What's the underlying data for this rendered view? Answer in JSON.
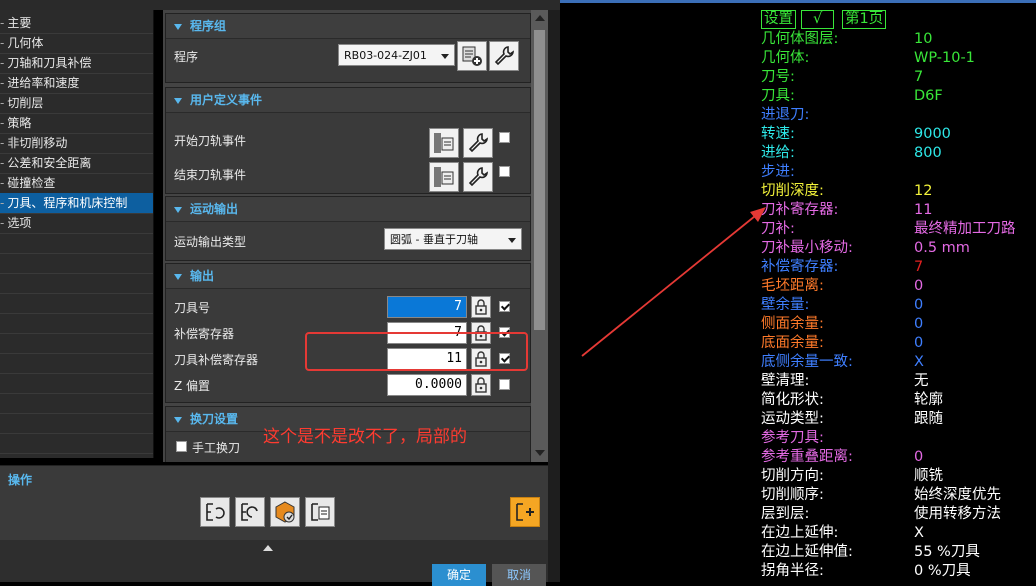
{
  "tree": {
    "items": [
      "主要",
      "几何体",
      "刀轴和刀具补偿",
      "进给率和速度",
      "切削层",
      "策略",
      "非切削移动",
      "公差和安全距离",
      "碰撞检查",
      "刀具、程序和机床控制",
      "选项"
    ],
    "prefix": "-",
    "selected_index": 9
  },
  "program_group": {
    "title": "程序组",
    "program_label": "程序",
    "program_value": "RB03-024-ZJ01"
  },
  "user_events": {
    "title": "用户定义事件",
    "start_label": "开始刀轨事件",
    "end_label": "结束刀轨事件"
  },
  "motion_output": {
    "title": "运动输出",
    "type_label": "运动输出类型",
    "type_value": "圆弧 - 垂直于刀轴"
  },
  "output": {
    "title": "输出",
    "rows": [
      {
        "label": "刀具号",
        "value": "7",
        "checked": true,
        "active": true
      },
      {
        "label": "补偿寄存器",
        "value": "7",
        "checked": true,
        "active": false
      },
      {
        "label": "刀具补偿寄存器",
        "value": "11",
        "checked": true,
        "active": false
      },
      {
        "label": "Z 偏置",
        "value": "0.0000",
        "checked": false,
        "active": false
      }
    ]
  },
  "tool_change": {
    "title": "换刀设置",
    "manual_label": "手工换刀"
  },
  "operations": {
    "title": "操作"
  },
  "buttons": {
    "ok": "确定",
    "cancel": "取消"
  },
  "annotation": {
    "text": "这个是不是改不了，局部的",
    "color": "#ff3b30"
  },
  "cam_header": {
    "settings": "设置",
    "check": "√",
    "page": "第1页"
  },
  "cam_rows": [
    {
      "label": "几何体图层:",
      "value": "10",
      "label_color": "#39e639",
      "value_color": "#39e639"
    },
    {
      "label": "几何体:",
      "value": "WP-10-1",
      "label_color": "#39e639",
      "value_color": "#39e639"
    },
    {
      "label": "刀号:",
      "value": "7",
      "label_color": "#39e639",
      "value_color": "#39e639"
    },
    {
      "label": "刀具:",
      "value": "D6F",
      "label_color": "#39e639",
      "value_color": "#39e639"
    },
    {
      "label": "进退刀:",
      "value": "",
      "label_color": "#3f7fff",
      "value_color": "#3f7fff"
    },
    {
      "label": "转速:",
      "value": "9000",
      "label_color": "#2ee8e8",
      "value_color": "#2ee8e8"
    },
    {
      "label": "进给:",
      "value": "800",
      "label_color": "#2ee8e8",
      "value_color": "#2ee8e8"
    },
    {
      "label": "步进:",
      "value": "",
      "label_color": "#3f7fff",
      "value_color": "#3f7fff"
    },
    {
      "label": "切削深度:",
      "value": "12",
      "label_color": "#f2f23a",
      "value_color": "#f2f23a"
    },
    {
      "label": "刀补寄存器:",
      "value": "11",
      "label_color": "#e46ae4",
      "value_color": "#e46ae4"
    },
    {
      "label": "刀补:",
      "value": "最终精加工刀路",
      "label_color": "#e46ae4",
      "value_color": "#e46ae4"
    },
    {
      "label": "刀补最小移动:",
      "value": "0.5  mm",
      "label_color": "#e46ae4",
      "value_color": "#e46ae4"
    },
    {
      "label": "补偿寄存器:",
      "value": "7",
      "label_color": "#3f7fff",
      "value_color": "#e02020"
    },
    {
      "label": "毛坯距离:",
      "value": "0",
      "label_color": "#ff7a2a",
      "value_color": "#e46ae4"
    },
    {
      "label": "壁余量:",
      "value": "0",
      "label_color": "#3f7fff",
      "value_color": "#3f7fff"
    },
    {
      "label": "侧面余量:",
      "value": "0",
      "label_color": "#ff7a2a",
      "value_color": "#3f7fff"
    },
    {
      "label": "底面余量:",
      "value": "0",
      "label_color": "#ff7a2a",
      "value_color": "#3f7fff"
    },
    {
      "label": "底侧余量一致:",
      "value": "X",
      "label_color": "#3f7fff",
      "value_color": "#3f7fff"
    },
    {
      "label": "壁清理:",
      "value": "无",
      "label_color": "#ffffff",
      "value_color": "#ffffff"
    },
    {
      "label": "简化形状:",
      "value": "轮廓",
      "label_color": "#ffffff",
      "value_color": "#ffffff"
    },
    {
      "label": "运动类型:",
      "value": "跟随",
      "label_color": "#ffffff",
      "value_color": "#ffffff"
    },
    {
      "label": "参考刀具:",
      "value": "",
      "label_color": "#e46ae4",
      "value_color": "#e46ae4"
    },
    {
      "label": "参考重叠距离:",
      "value": "0",
      "label_color": "#e46ae4",
      "value_color": "#e46ae4"
    },
    {
      "label": "切削方向:",
      "value": "顺铣",
      "label_color": "#ffffff",
      "value_color": "#ffffff"
    },
    {
      "label": "切削顺序:",
      "value": "始终深度优先",
      "label_color": "#ffffff",
      "value_color": "#ffffff"
    },
    {
      "label": "层到层:",
      "value": "使用转移方法",
      "label_color": "#ffffff",
      "value_color": "#ffffff"
    },
    {
      "label": "在边上延伸:",
      "value": "X",
      "label_color": "#ffffff",
      "value_color": "#ffffff"
    },
    {
      "label": "在边上延伸值:",
      "value": "55   %刀具",
      "label_color": "#ffffff",
      "value_color": "#ffffff"
    },
    {
      "label": "拐角半径:",
      "value": "0    %刀具",
      "label_color": "#ffffff",
      "value_color": "#ffffff"
    }
  ]
}
